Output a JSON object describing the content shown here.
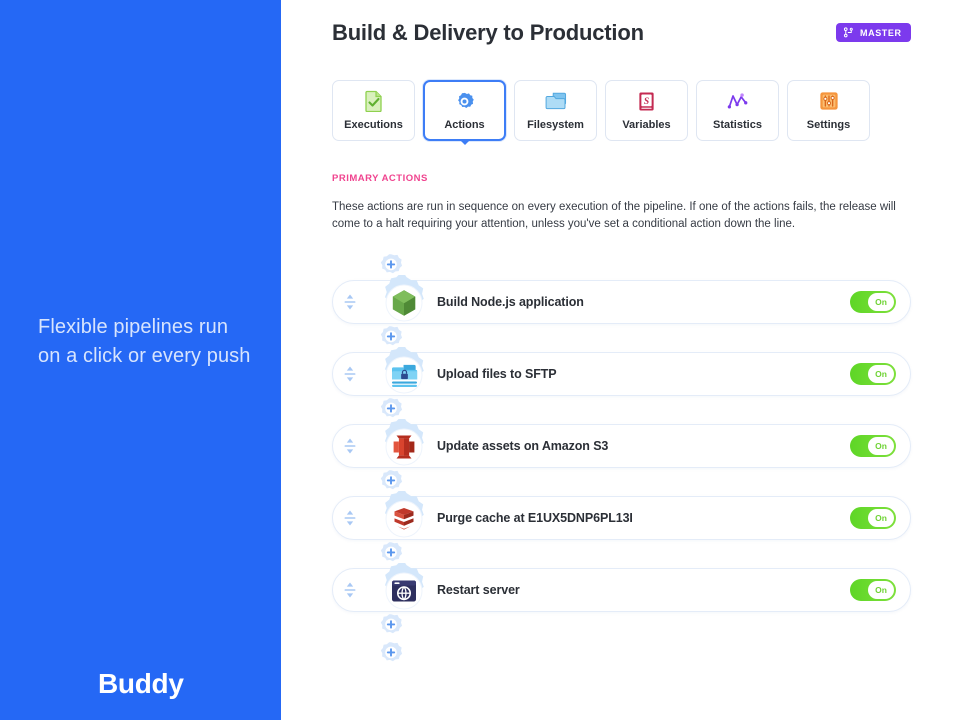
{
  "sidebar": {
    "tagline": "Flexible pipelines run on a click or every push",
    "logo": "Buddy",
    "bg_color": "#2568f5"
  },
  "header": {
    "title": "Build & Delivery to Production",
    "branch_badge": {
      "label": "MASTER",
      "icon": "git-branch-icon",
      "color": "#7c3aed"
    }
  },
  "tabs": [
    {
      "label": "Executions",
      "icon": "document-check-icon",
      "active": false
    },
    {
      "label": "Actions",
      "icon": "gear-icon",
      "active": true
    },
    {
      "label": "Filesystem",
      "icon": "folder-icon",
      "active": false
    },
    {
      "label": "Variables",
      "icon": "variable-book-icon",
      "active": false
    },
    {
      "label": "Statistics",
      "icon": "line-chart-icon",
      "active": false
    },
    {
      "label": "Settings",
      "icon": "sliders-icon",
      "active": false
    }
  ],
  "section": {
    "label": "PRIMARY ACTIONS",
    "label_color": "#f0448f",
    "description": "These actions are run in sequence on every execution of the pipeline. If one of the actions fails, the release will come to a halt requiring your attention, unless you've set a conditional action down the line."
  },
  "pipeline": {
    "add_button_label": "+",
    "toggle_on_label": "On",
    "actions": [
      {
        "label": "Build Node.js application",
        "icon": "nodejs-icon",
        "enabled": true
      },
      {
        "label": "Upload files to SFTP",
        "icon": "sftp-folder-lock-icon",
        "enabled": true
      },
      {
        "label": "Update assets on Amazon S3",
        "icon": "amazon-s3-icon",
        "enabled": true
      },
      {
        "label": "Purge cache at E1UX5DNP6PL13I",
        "icon": "cloudfront-icon",
        "enabled": true
      },
      {
        "label": "Restart server",
        "icon": "browser-globe-icon",
        "enabled": true
      }
    ]
  }
}
